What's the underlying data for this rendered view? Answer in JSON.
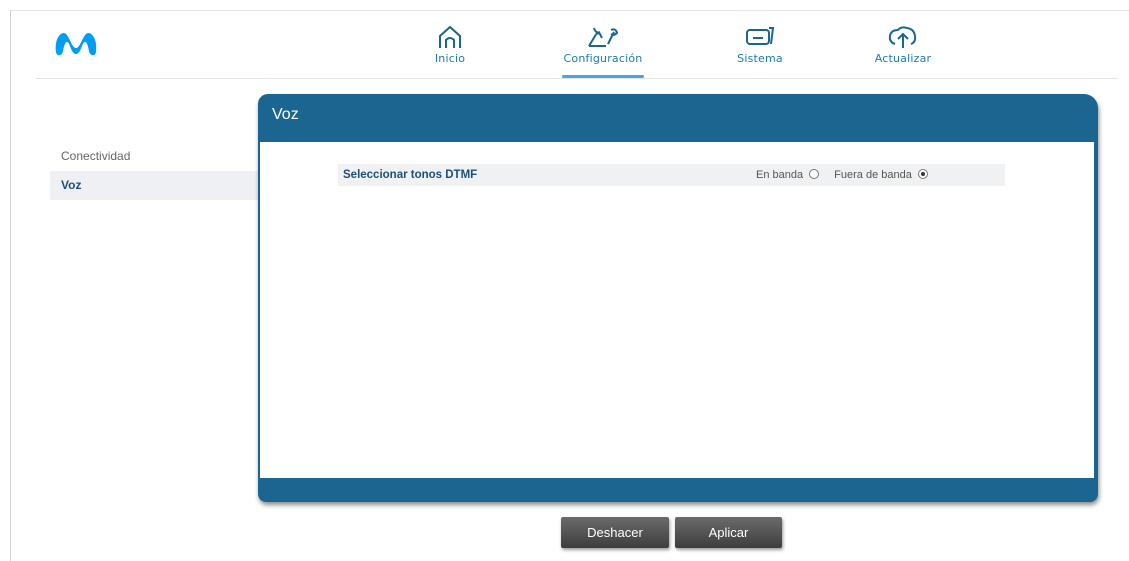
{
  "header": {
    "brand": "movistar",
    "nav": [
      {
        "label": "Inicio",
        "icon": "home-icon"
      },
      {
        "label": "Configuración",
        "icon": "configuration-icon",
        "active": true
      },
      {
        "label": "Sistema",
        "icon": "system-icon"
      },
      {
        "label": "Actualizar",
        "icon": "update-icon"
      }
    ]
  },
  "sidebar": {
    "items": [
      {
        "label": "Conectividad",
        "active": false
      },
      {
        "label": "Voz",
        "active": true
      }
    ]
  },
  "panel": {
    "title": "Voz",
    "dtmf": {
      "label": "Seleccionar tonos DTMF",
      "options": [
        {
          "label": "En banda",
          "checked": false
        },
        {
          "label": "Fuera de banda",
          "checked": true
        }
      ]
    }
  },
  "actions": {
    "undo_label": "Deshacer",
    "apply_label": "Aplicar"
  },
  "colors": {
    "accent": "#1a6690",
    "nav_text": "#1a7bb5",
    "logo": "#019df4"
  }
}
